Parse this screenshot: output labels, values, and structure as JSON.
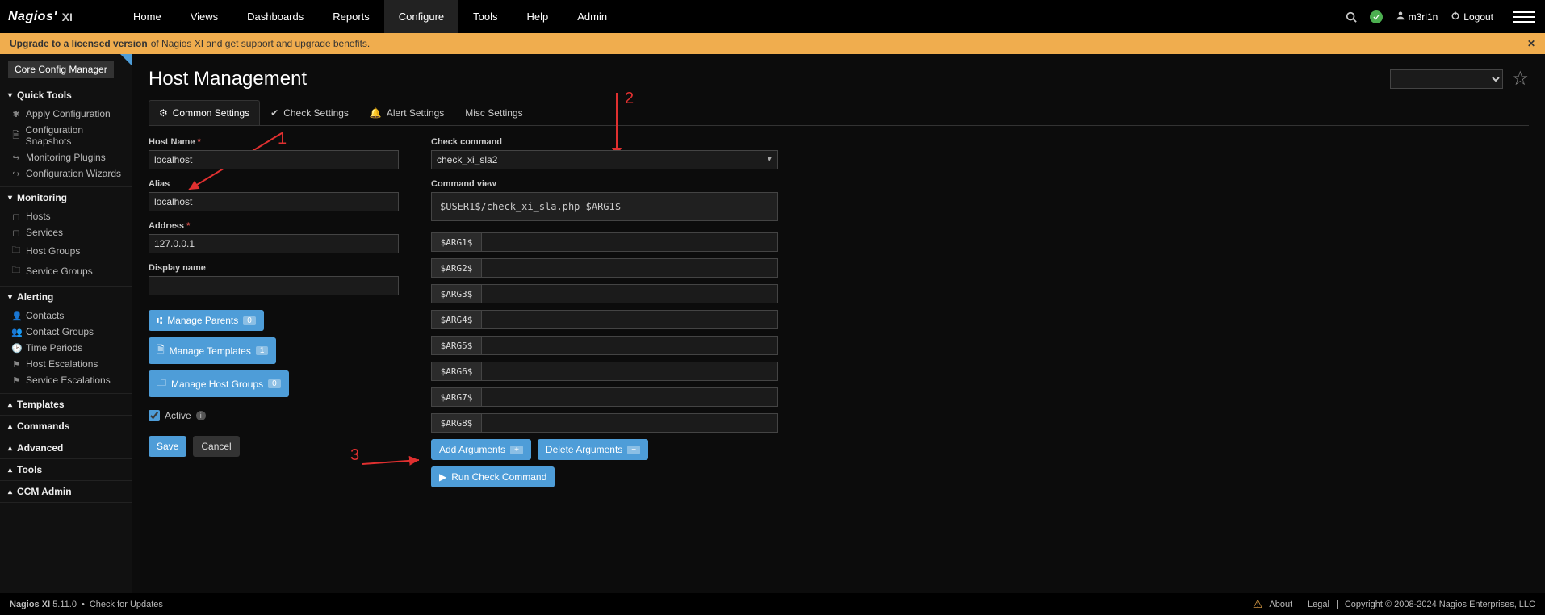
{
  "nav": {
    "items": [
      "Home",
      "Views",
      "Dashboards",
      "Reports",
      "Configure",
      "Tools",
      "Help",
      "Admin"
    ],
    "active": 4
  },
  "user": {
    "name": "m3rl1n",
    "logout": "Logout"
  },
  "banner": {
    "bold": "Upgrade to a licensed version",
    "rest": " of Nagios XI and get support and upgrade benefits."
  },
  "sidebar": {
    "title": "Core Config Manager",
    "sections": [
      {
        "label": "Quick Tools",
        "open": true,
        "items": [
          {
            "icon": "✱",
            "label": "Apply Configuration"
          },
          {
            "icon": "🗎",
            "label": "Configuration Snapshots"
          },
          {
            "icon": "↪",
            "label": "Monitoring Plugins"
          },
          {
            "icon": "↪",
            "label": "Configuration Wizards"
          }
        ]
      },
      {
        "label": "Monitoring",
        "open": true,
        "items": [
          {
            "icon": "◻",
            "label": "Hosts"
          },
          {
            "icon": "◻",
            "label": "Services"
          },
          {
            "icon": "🗀",
            "label": "Host Groups"
          },
          {
            "icon": "🗀",
            "label": "Service Groups"
          }
        ]
      },
      {
        "label": "Alerting",
        "open": true,
        "items": [
          {
            "icon": "👤",
            "label": "Contacts"
          },
          {
            "icon": "👥",
            "label": "Contact Groups"
          },
          {
            "icon": "🕑",
            "label": "Time Periods"
          },
          {
            "icon": "⚑",
            "label": "Host Escalations"
          },
          {
            "icon": "⚑",
            "label": "Service Escalations"
          }
        ]
      },
      {
        "label": "Templates",
        "open": false
      },
      {
        "label": "Commands",
        "open": false
      },
      {
        "label": "Advanced",
        "open": false
      },
      {
        "label": "Tools",
        "open": false
      },
      {
        "label": "CCM Admin",
        "open": false
      }
    ]
  },
  "page": {
    "title": "Host Management",
    "tabs": [
      {
        "icon": "⚙",
        "label": "Common Settings"
      },
      {
        "icon": "✔",
        "label": "Check Settings"
      },
      {
        "icon": "🔔",
        "label": "Alert Settings"
      },
      {
        "icon": "",
        "label": "Misc Settings"
      }
    ],
    "active_tab": 0
  },
  "form": {
    "host_name_label": "Host Name",
    "host_name": "localhost",
    "alias_label": "Alias",
    "alias": "localhost",
    "address_label": "Address",
    "address": "127.0.0.1",
    "display_label": "Display name",
    "display": "",
    "manage_parents": {
      "label": "Manage Parents",
      "count": "0"
    },
    "manage_templates": {
      "label": "Manage Templates",
      "count": "1"
    },
    "manage_host_groups": {
      "label": "Manage Host Groups",
      "count": "0"
    },
    "active_label": "Active",
    "active_checked": true,
    "save": "Save",
    "cancel": "Cancel"
  },
  "check": {
    "command_label": "Check command",
    "command": "check_xi_sla2",
    "view_label": "Command view",
    "view": "$USER1$/check_xi_sla.php $ARG1$",
    "args": [
      "$ARG1$",
      "$ARG2$",
      "$ARG3$",
      "$ARG4$",
      "$ARG5$",
      "$ARG6$",
      "$ARG7$",
      "$ARG8$"
    ],
    "add_args": "Add Arguments",
    "del_args": "Delete Arguments",
    "run": "Run Check Command"
  },
  "annotations": {
    "a1": "1",
    "a2": "2",
    "a3": "3"
  },
  "footer": {
    "product": "Nagios XI",
    "version": "5.11.0",
    "check_updates": "Check for Updates",
    "about": "About",
    "legal": "Legal",
    "copyright": "Copyright © 2008-2024 Nagios Enterprises, LLC"
  }
}
